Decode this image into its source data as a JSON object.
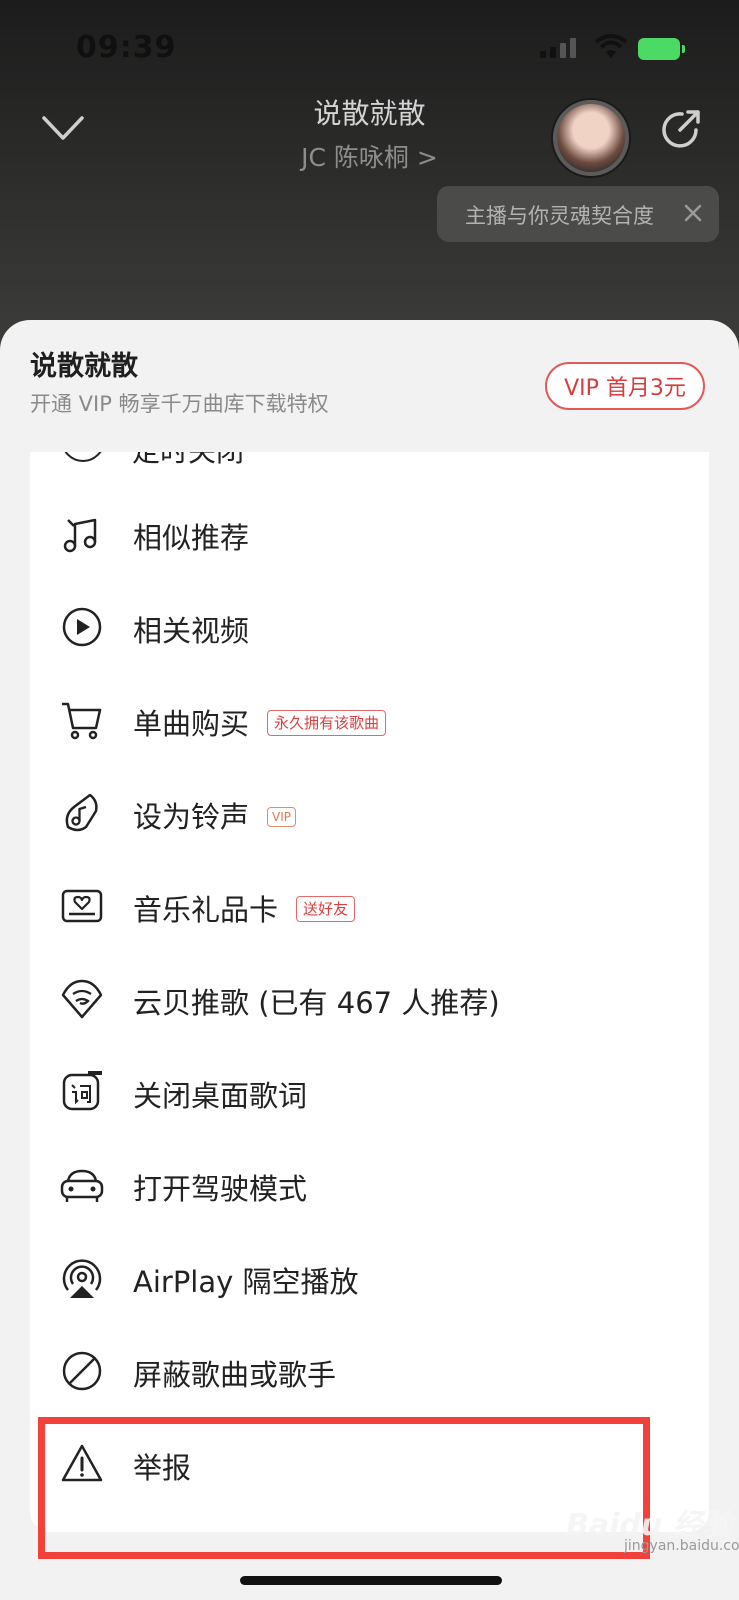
{
  "status_bar": {
    "time": "09:39"
  },
  "player": {
    "song_title": "说散就散",
    "artist": "JC 陈咏桐 >",
    "tooltip": "主播与你灵魂契合度"
  },
  "sheet": {
    "title": "说散就散",
    "subtitle": "开通 VIP 畅享千万曲库下载特权",
    "vip_button": "VIP 首月3元",
    "partial_item": "定时关闭",
    "items": [
      {
        "label": "相似推荐",
        "icon": "music-notes-icon"
      },
      {
        "label": "相关视频",
        "icon": "play-video-icon"
      },
      {
        "label": "单曲购买",
        "icon": "cart-icon",
        "tag": "永久拥有该歌曲"
      },
      {
        "label": "设为铃声",
        "icon": "ringtone-icon",
        "tag": "VIP"
      },
      {
        "label": "音乐礼品卡",
        "icon": "gift-card-icon",
        "tag": "送好友"
      },
      {
        "label": "云贝推歌 (已有 467 人推荐)",
        "icon": "cloud-shell-icon"
      },
      {
        "label": "关闭桌面歌词",
        "icon": "lyrics-icon"
      },
      {
        "label": "打开驾驶模式",
        "icon": "car-icon"
      },
      {
        "label": "AirPlay 隔空播放",
        "icon": "airplay-icon"
      },
      {
        "label": "屏蔽歌曲或歌手",
        "icon": "block-icon"
      },
      {
        "label": "举报",
        "icon": "warning-icon"
      }
    ]
  },
  "watermark": {
    "brand": "Baidu 经验",
    "url": "jingyan.baidu.com"
  },
  "colors": {
    "accent": "#d93c3c",
    "highlight": "#f2403a",
    "battery": "#4cd964"
  }
}
